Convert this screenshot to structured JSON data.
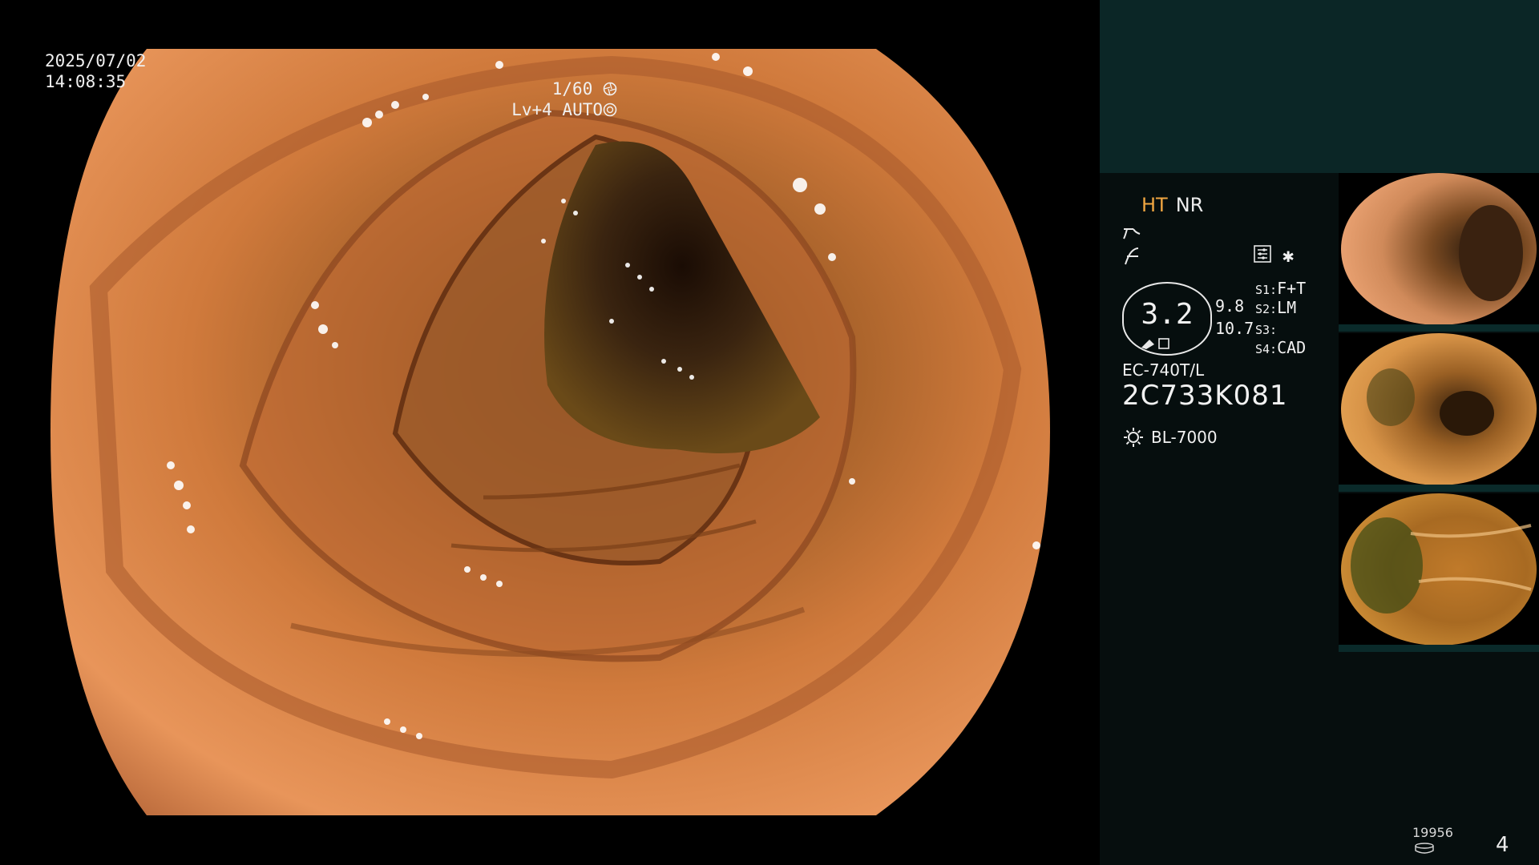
{
  "overlay": {
    "date": "2025/07/02",
    "time": "14:08:35",
    "shutter": "1/60",
    "level": "Lv+4",
    "iris": "AUTO"
  },
  "panel": {
    "mode_ht": "HT",
    "mode_nr": "NR",
    "zoom": "3.2",
    "scale_top": "9.8",
    "scale_bottom": "10.7",
    "scope_model": "EC-740T/L",
    "scope_serial": "2C733K081",
    "light_source": "BL-7000",
    "switches": [
      {
        "key": "S1:",
        "value": "F+T"
      },
      {
        "key": "S2:",
        "value": "LM"
      },
      {
        "key": "S3:",
        "value": ""
      },
      {
        "key": "S4:",
        "value": "CAD"
      }
    ],
    "counter": "19956",
    "page": "4"
  },
  "icons": {
    "shutter": "aperture-icon",
    "iris": "iris-icon",
    "edge": "edge-enhance-icon",
    "contrast": "contrast-icon",
    "settings": "settings-list-icon",
    "star": "asterisk-icon",
    "light": "light-source-icon",
    "counter": "storage-icon"
  },
  "colors": {
    "ht_accent": "#f0a641",
    "panel_bg": "#060e0e",
    "panel_top": "#0b2626"
  }
}
